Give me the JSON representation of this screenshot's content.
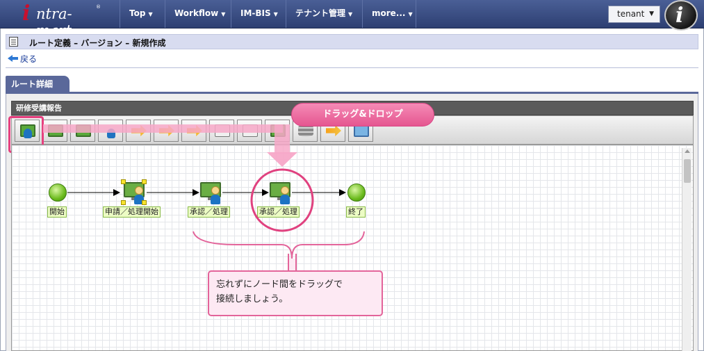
{
  "nav": {
    "logo": "intra-mart",
    "items": [
      {
        "label": "Top"
      },
      {
        "label": "Workflow"
      },
      {
        "label": "IM-BIS"
      },
      {
        "label": "テナント管理"
      },
      {
        "label": "more..."
      }
    ],
    "tenant": "tenant"
  },
  "page": {
    "title": "ルート定義 – バージョン – 新規作成",
    "back": "戻る",
    "tab": "ルート詳細"
  },
  "route": {
    "name": "研修受講報告"
  },
  "toolbar": {
    "icons": [
      "user-node-icon",
      "approve-node-icon",
      "confirm-node-icon",
      "system-node-icon",
      "branch-icon",
      "merge-icon",
      "split-icon",
      "join-icon",
      "document-icon",
      "horizontal-icon",
      "vertical-icon",
      "database-icon",
      "branch-node-icon",
      "window-icon"
    ]
  },
  "flow": {
    "nodes": [
      {
        "label": "開始"
      },
      {
        "label": "申請／処理開始"
      },
      {
        "label": "承認／処理"
      },
      {
        "label": "承認／処理"
      },
      {
        "label": "終了"
      }
    ]
  },
  "callouts": {
    "drag": "ドラッグ&ドロップ",
    "note_line1": "忘れずにノード間をドラッグで",
    "note_line2": "接続しましょう。"
  },
  "colors": {
    "nav_bg": "#3a4c82",
    "tab_bg": "#5a689a",
    "callout_pink": "#e55690",
    "node_green": "#6cbb1e"
  }
}
